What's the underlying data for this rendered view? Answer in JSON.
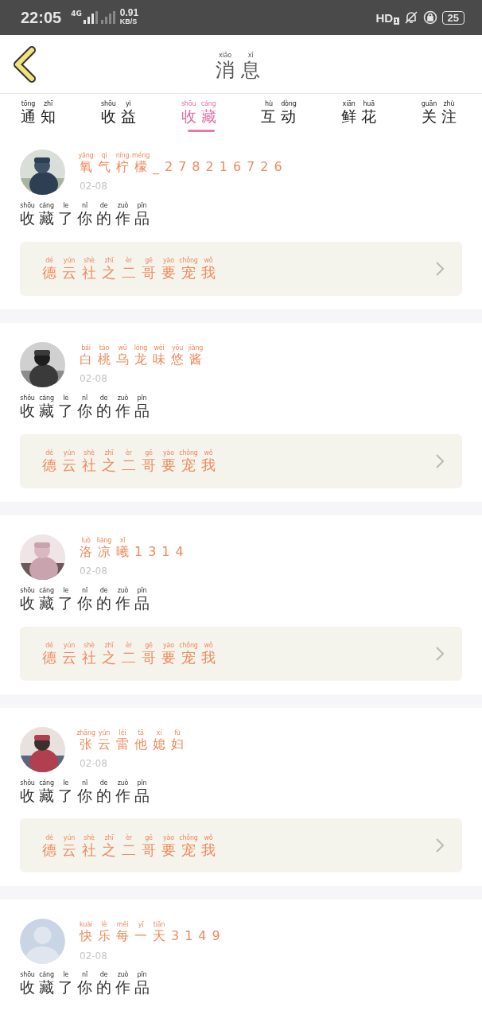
{
  "status_bar": {
    "time": "22:05",
    "network": "4G",
    "speed": "0.91",
    "speed_unit": "KB/S",
    "hd": "HD",
    "sim": "1",
    "battery": "25"
  },
  "header": {
    "title": {
      "text": "消息",
      "pinyin": [
        "xiāo",
        "xī"
      ]
    }
  },
  "tabs": [
    {
      "text": "通知",
      "pinyin": [
        "tōng",
        "zhī"
      ],
      "selected": false
    },
    {
      "text": "收益",
      "pinyin": [
        "shōu",
        "yì"
      ],
      "selected": false
    },
    {
      "text": "收藏",
      "pinyin": [
        "shōu",
        "cáng"
      ],
      "selected": true
    },
    {
      "text": "互动",
      "pinyin": [
        "hù",
        "dòng"
      ],
      "selected": false
    },
    {
      "text": "鲜花",
      "pinyin": [
        "xiān",
        "huā"
      ],
      "selected": false
    },
    {
      "text": "关注",
      "pinyin": [
        "guān",
        "zhù"
      ],
      "selected": false
    }
  ],
  "items": [
    {
      "name": {
        "text": "氧气柠檬_278216726",
        "pinyin": [
          "yǎng",
          "qì",
          "níng",
          "méng"
        ]
      },
      "date": "02-08",
      "action": {
        "text": "收藏了你的作品",
        "pinyin": [
          "shōu",
          "cáng",
          "le",
          "nǐ",
          "de",
          "zuò",
          "pǐn"
        ]
      },
      "work": {
        "text": "德云社之二哥要宠我",
        "pinyin": [
          "dé",
          "yún",
          "shè",
          "zhī",
          "èr",
          "gē",
          "yào",
          "chǒng",
          "wǒ"
        ]
      }
    },
    {
      "name": {
        "text": "白桃乌龙味悠酱",
        "pinyin": [
          "bái",
          "táo",
          "wū",
          "lóng",
          "wèi",
          "yōu",
          "jiàng"
        ]
      },
      "date": "02-08",
      "action": {
        "text": "收藏了你的作品",
        "pinyin": [
          "shōu",
          "cáng",
          "le",
          "nǐ",
          "de",
          "zuò",
          "pǐn"
        ]
      },
      "work": {
        "text": "德云社之二哥要宠我",
        "pinyin": [
          "dé",
          "yún",
          "shè",
          "zhī",
          "èr",
          "gē",
          "yào",
          "chǒng",
          "wǒ"
        ]
      }
    },
    {
      "name": {
        "text": "洛凉曦1314",
        "pinyin": [
          "luò",
          "liáng",
          "xī"
        ]
      },
      "date": "02-08",
      "action": {
        "text": "收藏了你的作品",
        "pinyin": [
          "shōu",
          "cáng",
          "le",
          "nǐ",
          "de",
          "zuò",
          "pǐn"
        ]
      },
      "work": {
        "text": "德云社之二哥要宠我",
        "pinyin": [
          "dé",
          "yún",
          "shè",
          "zhī",
          "èr",
          "gē",
          "yào",
          "chǒng",
          "wǒ"
        ]
      }
    },
    {
      "name": {
        "text": "张云雷他媳妇",
        "pinyin": [
          "zhāng",
          "yún",
          "léi",
          "tā",
          "xí",
          "fù"
        ]
      },
      "date": "02-08",
      "action": {
        "text": "收藏了你的作品",
        "pinyin": [
          "shōu",
          "cáng",
          "le",
          "nǐ",
          "de",
          "zuò",
          "pǐn"
        ]
      },
      "work": {
        "text": "德云社之二哥要宠我",
        "pinyin": [
          "dé",
          "yún",
          "shè",
          "zhī",
          "èr",
          "gē",
          "yào",
          "chǒng",
          "wǒ"
        ]
      }
    },
    {
      "avatar": {
        "kind": "placeholder"
      },
      "name": {
        "text": "快乐每一天3149",
        "pinyin": [
          "kuài",
          "lè",
          "měi",
          "yī",
          "tiān"
        ]
      },
      "date": "02-08",
      "action": {
        "text": "收藏了你的作品",
        "pinyin": [
          "shōu",
          "cáng",
          "le",
          "nǐ",
          "de",
          "zuò",
          "pǐn"
        ]
      }
    }
  ]
}
